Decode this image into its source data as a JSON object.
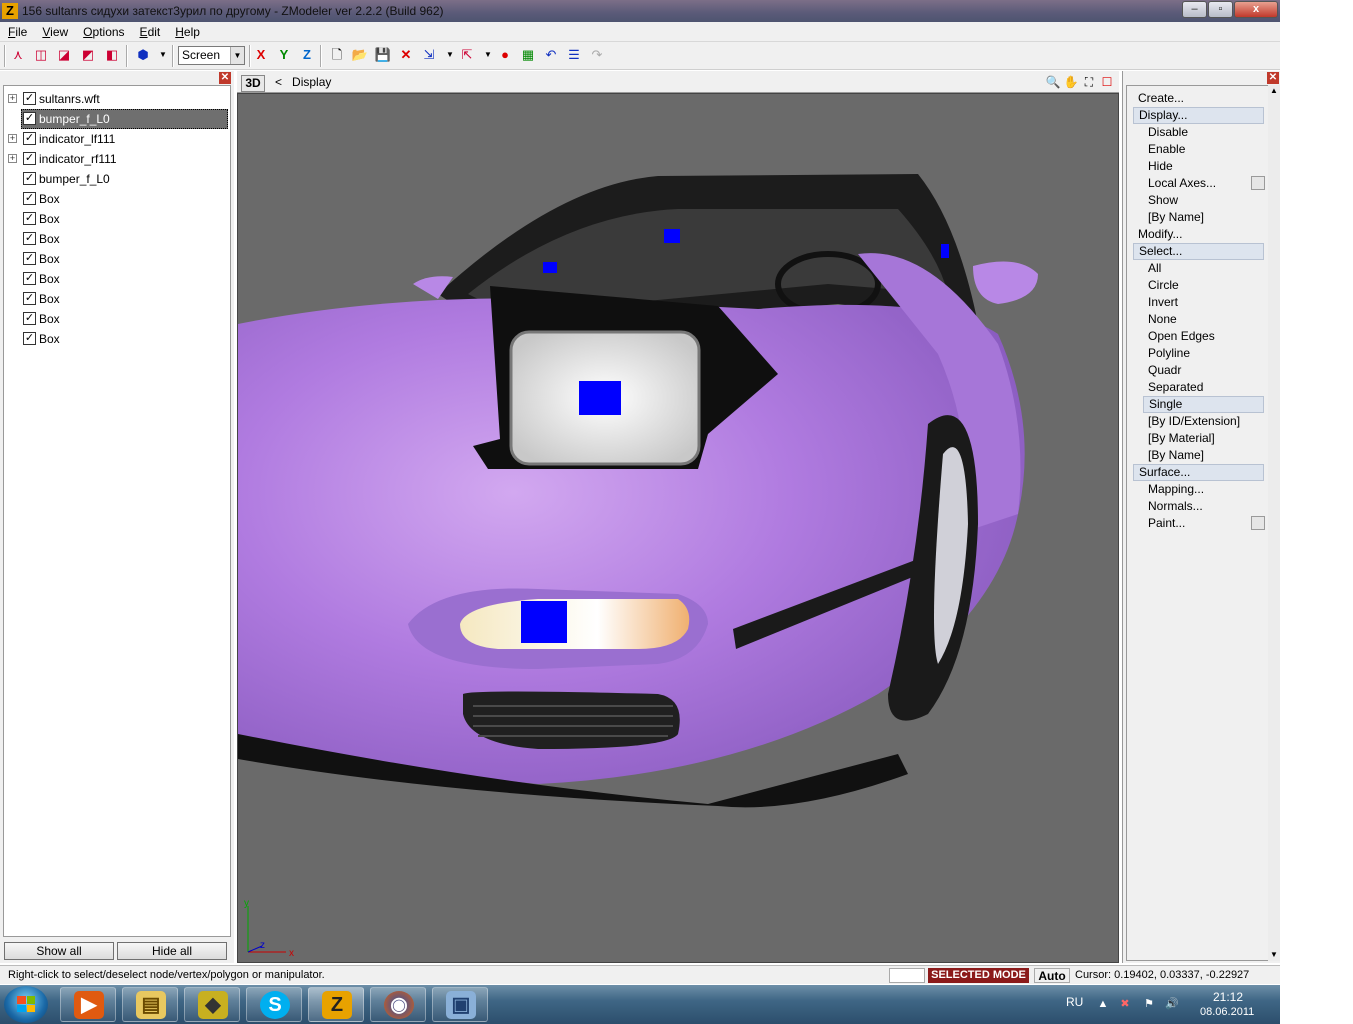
{
  "window": {
    "icon_letter": "Z",
    "title": "156 sultanrs сидухи затекст3урил по другому - ZModeler ver 2.2.2 (Build 962)",
    "minimize": "–",
    "maximize": "▫",
    "close": "x"
  },
  "menu": [
    "File",
    "View",
    "Options",
    "Edit",
    "Help"
  ],
  "toolbar": {
    "coord_mode": "Screen",
    "axis_x": "X",
    "axis_y": "Y",
    "axis_z": "Z"
  },
  "tree": {
    "items": [
      {
        "label": "sultanrs.wft",
        "expandable": true,
        "checked": true
      },
      {
        "label": "bumper_f_L0",
        "expandable": false,
        "checked": true,
        "selected": true
      },
      {
        "label": "indicator_lf111",
        "expandable": true,
        "checked": true
      },
      {
        "label": "indicator_rf111",
        "expandable": true,
        "checked": true
      },
      {
        "label": "bumper_f_L0",
        "expandable": false,
        "checked": true
      },
      {
        "label": "Box",
        "expandable": false,
        "checked": true
      },
      {
        "label": "Box",
        "expandable": false,
        "checked": true
      },
      {
        "label": "Box",
        "expandable": false,
        "checked": true
      },
      {
        "label": "Box",
        "expandable": false,
        "checked": true
      },
      {
        "label": "Box",
        "expandable": false,
        "checked": true
      },
      {
        "label": "Box",
        "expandable": false,
        "checked": true
      },
      {
        "label": "Box",
        "expandable": false,
        "checked": true
      },
      {
        "label": "Box",
        "expandable": false,
        "checked": true
      }
    ],
    "show_all": "Show all",
    "hide_all": "Hide all"
  },
  "viewport": {
    "view_label": "3D",
    "breadcrumb_arrow": "<",
    "breadcrumb": "Display",
    "axis_y": "y",
    "axis_z": "z",
    "axis_x": "x"
  },
  "commands": {
    "items": [
      {
        "label": "Create...",
        "level": 0
      },
      {
        "label": "Display...",
        "level": 0,
        "highlight": true
      },
      {
        "label": "Disable",
        "level": 1
      },
      {
        "label": "Enable",
        "level": 1
      },
      {
        "label": "Hide",
        "level": 1
      },
      {
        "label": "Local Axes...",
        "level": 1,
        "checkbox": true
      },
      {
        "label": "Show",
        "level": 1
      },
      {
        "label": "[By Name]",
        "level": 1
      },
      {
        "label": "Modify...",
        "level": 0
      },
      {
        "label": "Select...",
        "level": 0,
        "highlight": true
      },
      {
        "label": "All",
        "level": 1
      },
      {
        "label": "Circle",
        "level": 1
      },
      {
        "label": "Invert",
        "level": 1
      },
      {
        "label": "None",
        "level": 1
      },
      {
        "label": "Open Edges",
        "level": 1
      },
      {
        "label": "Polyline",
        "level": 1
      },
      {
        "label": "Quadr",
        "level": 1
      },
      {
        "label": "Separated",
        "level": 1
      },
      {
        "label": "Single",
        "level": 1,
        "highlight": true
      },
      {
        "label": "[By ID/Extension]",
        "level": 1
      },
      {
        "label": "[By Material]",
        "level": 1
      },
      {
        "label": "[By Name]",
        "level": 1
      },
      {
        "label": "Surface...",
        "level": 0,
        "highlight": true
      },
      {
        "label": "Mapping...",
        "level": 1
      },
      {
        "label": "Normals...",
        "level": 1
      },
      {
        "label": "Paint...",
        "level": 1,
        "checkbox": true
      }
    ]
  },
  "status": {
    "message": "Right-click to select/deselect node/vertex/polygon or manipulator.",
    "mode": "SELECTED MODE",
    "auto": "Auto",
    "cursor": "Cursor: 0.19402, 0.03337, -0.22927"
  },
  "taskbar": {
    "language": "RU",
    "time": "21:12",
    "date": "08.06.2011",
    "apps": [
      "media-player",
      "file-explorer",
      "game-tool",
      "skype",
      "zmodeler",
      "firefox",
      "image-viewer"
    ]
  },
  "colors": {
    "car_body": "#b07be0",
    "selection_marker": "#0000ff",
    "viewport_bg": "#6a6a6a",
    "mode_badge": "#8b1a1a"
  }
}
